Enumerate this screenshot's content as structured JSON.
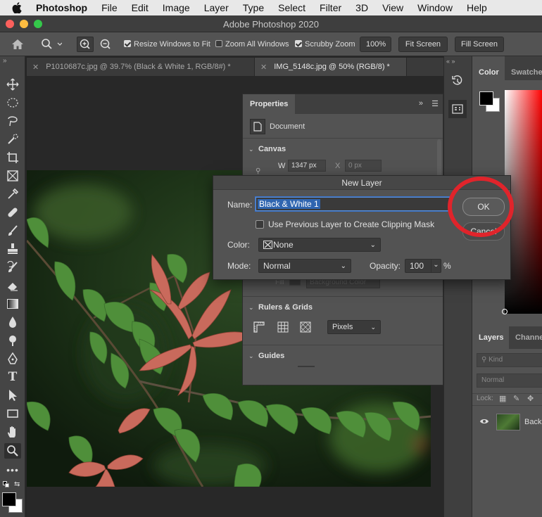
{
  "menubar": {
    "app": "Photoshop",
    "items": [
      "File",
      "Edit",
      "Image",
      "Layer",
      "Type",
      "Select",
      "Filter",
      "3D",
      "View",
      "Window",
      "Help"
    ]
  },
  "window": {
    "title": "Adobe Photoshop 2020"
  },
  "options": {
    "resize_windows_label": "Resize Windows to Fit",
    "zoom_all_label": "Zoom All Windows",
    "scrubby_label": "Scrubby Zoom",
    "zoom_value": "100%",
    "fit_screen_label": "Fit Screen",
    "fill_screen_label": "Fill Screen"
  },
  "doc_tabs": [
    {
      "label": "P1010687c.jpg @ 39.7% (Black & White 1, RGB/8#) *"
    },
    {
      "label": "IMG_5148c.jpg @ 50% (RGB/8) *"
    }
  ],
  "properties": {
    "title": "Properties",
    "document_label": "Document",
    "canvas_label": "Canvas",
    "w_label": "W",
    "w_value": "1347 px",
    "x_label": "X",
    "x_value": "0 px",
    "fill_label": "Fill",
    "fill_value": "Background Color",
    "rulers_label": "Rulers & Grids",
    "units_value": "Pixels",
    "guides_label": "Guides"
  },
  "right_panel": {
    "color_tab": "Color",
    "swatches_tab": "Swatche",
    "layers_tab": "Layers",
    "channels_tab": "Channe",
    "kind_placeholder": "Kind",
    "blend_value": "Normal",
    "lock_label": "Lock:",
    "layer_name": "Backg"
  },
  "dialog": {
    "title": "New Layer",
    "name_label": "Name:",
    "name_value": "Black & White 1",
    "clipping_label": "Use Previous Layer to Create Clipping Mask",
    "color_label": "Color:",
    "color_value": "None",
    "mode_label": "Mode:",
    "mode_value": "Normal",
    "opacity_label": "Opacity:",
    "opacity_value": "100",
    "percent": "%",
    "ok_label": "OK",
    "cancel_label": "Cancel"
  },
  "colors": {
    "annotation_circle": "#e0242b",
    "name_highlight": "#2f65b0",
    "leaf_red": "#c96a5c",
    "leaf_green": "#4f8f3a"
  }
}
